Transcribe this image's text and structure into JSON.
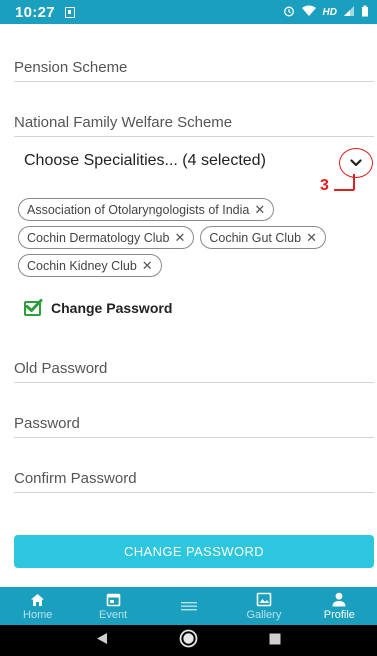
{
  "status_bar": {
    "time": "10:27",
    "network": "HD"
  },
  "fields": {
    "pension_scheme": "Pension Scheme",
    "national_family_welfare": "National Family Welfare Scheme"
  },
  "specialities": {
    "label": "Choose Specialities... (4 selected)",
    "annotation": "3",
    "selected": [
      "Association of Otolaryngologists of India",
      "Cochin Dermatology Club",
      "Cochin Gut Club",
      "Cochin Kidney Club"
    ],
    "remove_glyph": "✕"
  },
  "change_password": {
    "checkbox_label": "Change Password",
    "checked": true,
    "old_password_placeholder": "Old Password",
    "password_placeholder": "Password",
    "confirm_password_placeholder": "Confirm Password",
    "button_label": "CHANGE PASSWORD"
  },
  "bottom_nav": {
    "items": [
      {
        "label": "Home",
        "icon": "home-icon"
      },
      {
        "label": "Event",
        "icon": "calendar-icon"
      },
      {
        "label": "",
        "icon": "menu-icon"
      },
      {
        "label": "Gallery",
        "icon": "gallery-icon"
      },
      {
        "label": "Profile",
        "icon": "person-icon"
      }
    ],
    "active": "Profile"
  },
  "colors": {
    "primary": "#1b9fbf",
    "button": "#2cc7de",
    "annotation": "#e02020",
    "checkbox": "#2e9e3a"
  }
}
